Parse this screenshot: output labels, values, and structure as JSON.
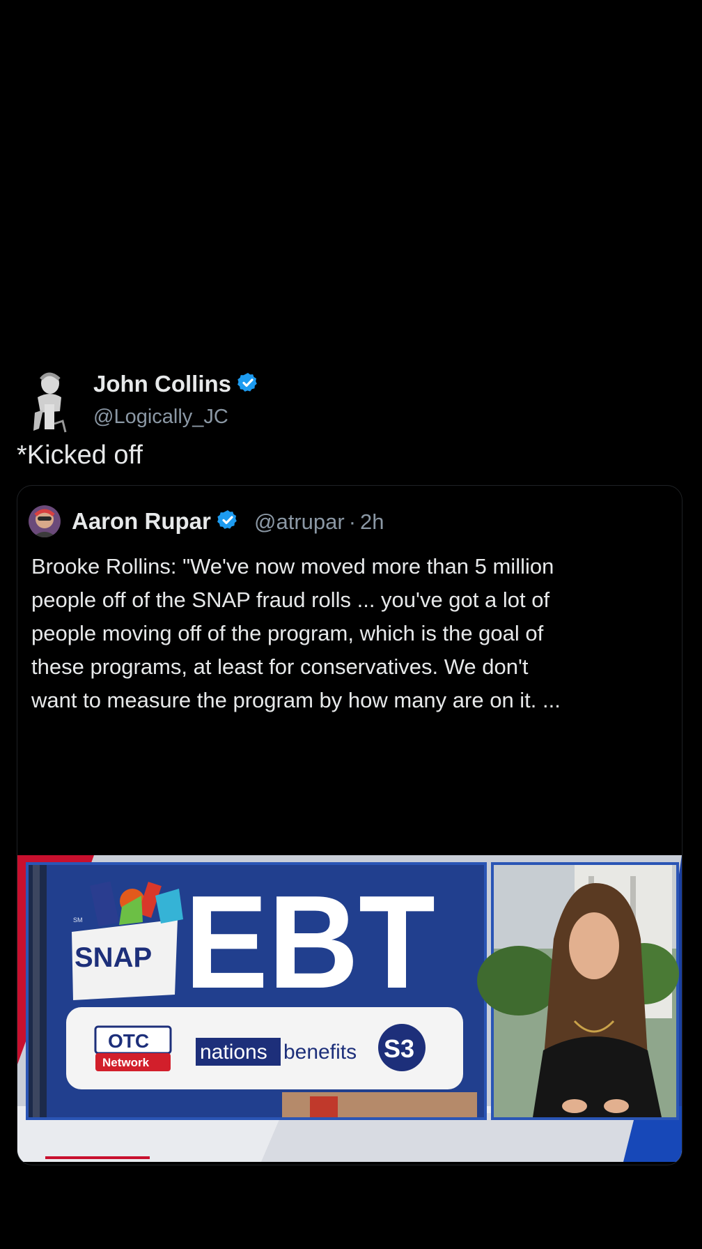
{
  "post": {
    "author_name": "John Collins",
    "author_handle": "@Logically_JC",
    "text": "*Kicked off",
    "verified_icon": "verified-badge-icon",
    "accent_color": "#1d9bf0"
  },
  "quoted_post": {
    "author_name": "Aaron Rupar",
    "author_handle": "@atrupar",
    "separator": "·",
    "time_ago": "2h",
    "body_lines": [
      "Brooke Rollins: \"We've now moved more than 5 million",
      "people off of the SNAP fraud rolls ... you've got a lot of",
      "people moving off of the program, which is the goal of",
      "these programs, at least for conservatives. We don't",
      "want to measure the program by how many are on it. ..."
    ],
    "media": {
      "sign_snap": "SNAP",
      "sign_ebt": "EBT",
      "sign_sm": "SM",
      "otc_top": "OTC",
      "otc_bottom": "Network",
      "nations": "nations",
      "benefits": "benefits",
      "s3_logo": "S3"
    }
  }
}
